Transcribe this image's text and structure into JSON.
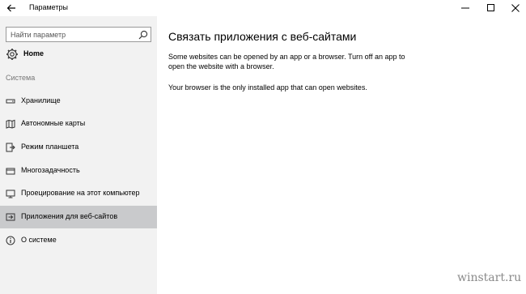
{
  "window": {
    "title": "Параметры",
    "back_icon": "back-arrow-icon",
    "minimize_icon": "minimize-icon",
    "maximize_icon": "maximize-icon",
    "close_icon": "close-icon"
  },
  "sidebar": {
    "search": {
      "placeholder": "Найти параметр",
      "value": "",
      "icon": "search-icon"
    },
    "home": {
      "label": "Home",
      "icon": "gear-icon"
    },
    "section_label": "Система",
    "items": [
      {
        "label": "Хранилище",
        "icon": "storage-icon",
        "selected": false
      },
      {
        "label": "Автономные карты",
        "icon": "map-icon",
        "selected": false
      },
      {
        "label": "Режим планшета",
        "icon": "tablet-mode-icon",
        "selected": false
      },
      {
        "label": "Многозадачность",
        "icon": "multitasking-icon",
        "selected": false
      },
      {
        "label": "Проецирование на этот компьютер",
        "icon": "projecting-icon",
        "selected": false
      },
      {
        "label": "Приложения для веб-сайтов",
        "icon": "web-apps-icon",
        "selected": true
      },
      {
        "label": "О системе",
        "icon": "info-icon",
        "selected": false
      }
    ]
  },
  "main": {
    "title": "Связать приложения с веб-сайтами",
    "description": "Some websites can be opened by an app or a browser.  Turn off an app to open the website with a browser.",
    "note": "Your browser is the only installed app that can open websites."
  },
  "watermark": "winstart.ru",
  "colors": {
    "sidebar_bg": "#f2f2f2",
    "selected_bg": "#c9cacc",
    "content_bg": "#ffffff"
  }
}
